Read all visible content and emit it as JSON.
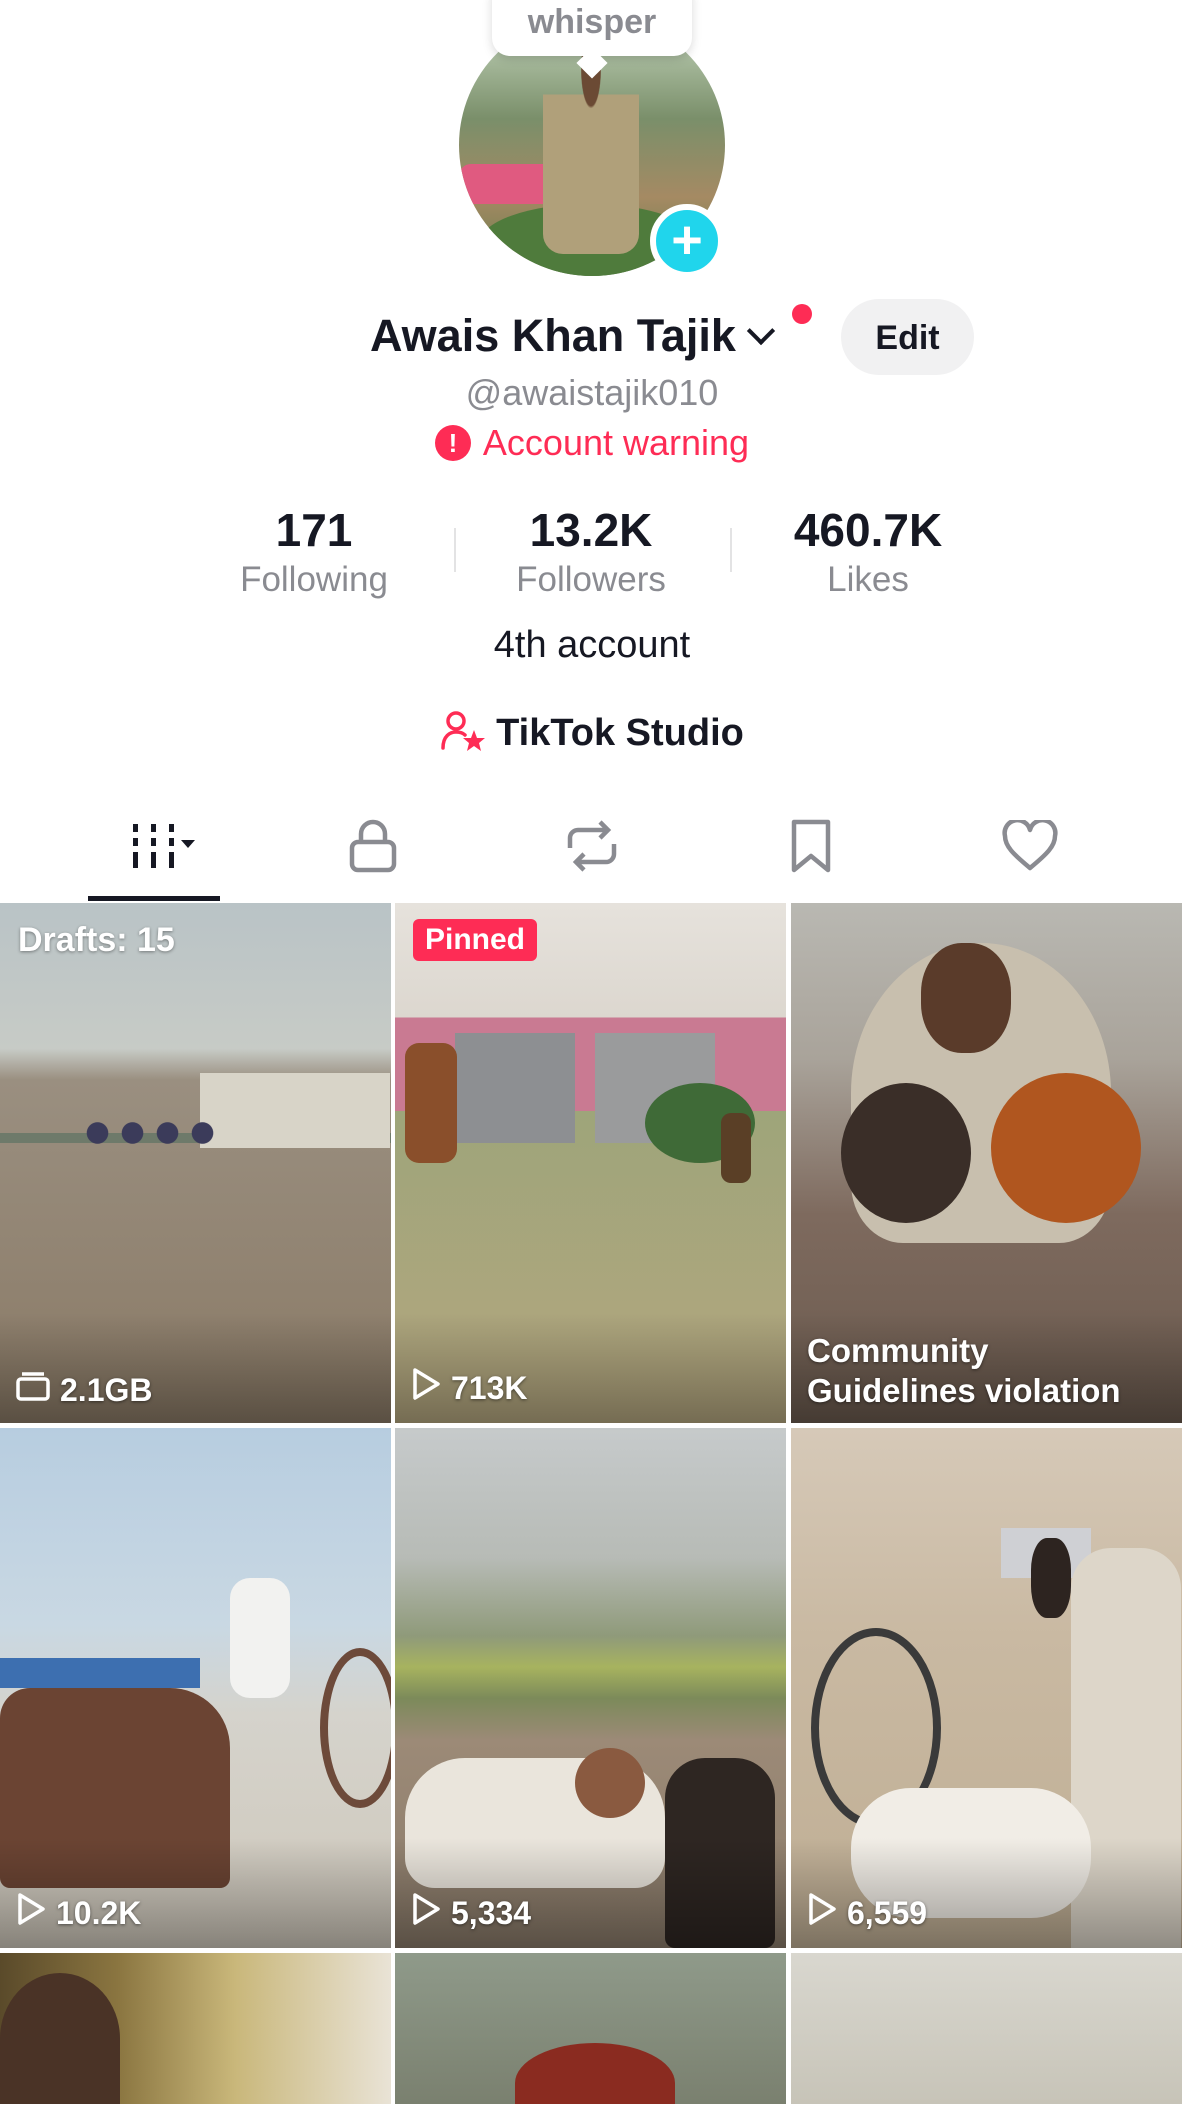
{
  "profile": {
    "whisper_label": "whisper",
    "display_name": "Awais Khan Tajik",
    "edit_label": "Edit",
    "username": "@awaistajik010",
    "warning_icon": "!",
    "warning_text": "Account warning",
    "bio": "4th account",
    "studio_label": "TikTok Studio",
    "add_symbol": "+"
  },
  "stats": [
    {
      "value": "171",
      "label": "Following"
    },
    {
      "value": "13.2K",
      "label": "Followers"
    },
    {
      "value": "460.7K",
      "label": "Likes"
    }
  ],
  "tabs": [
    {
      "icon": "videos-grid-icon"
    },
    {
      "icon": "lock-icon"
    },
    {
      "icon": "repost-icon"
    },
    {
      "icon": "bookmark-icon"
    },
    {
      "icon": "heart-icon"
    }
  ],
  "grid": {
    "drafts": {
      "label": "Drafts: 15",
      "size": "2.1GB"
    },
    "pinned": {
      "badge": "Pinned",
      "views": "713K"
    },
    "violation": {
      "line1": "Community",
      "line2": "Guidelines violation"
    },
    "row2": [
      {
        "views": "10.2K"
      },
      {
        "views": "5,334"
      },
      {
        "views": "6,559"
      }
    ]
  },
  "colors": {
    "accent_red": "#fe2c55",
    "accent_cyan": "#20d5ec",
    "text_primary": "#161823",
    "text_secondary": "#8a8b91"
  }
}
